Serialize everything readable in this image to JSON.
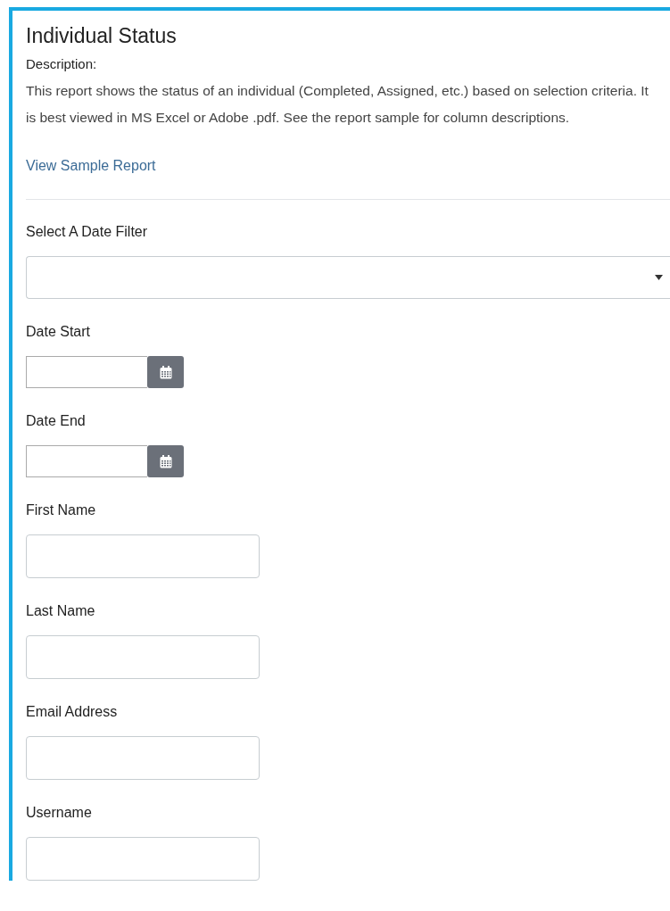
{
  "title": "Individual Status",
  "description_label": "Description:",
  "description": "This report shows the status of an individual (Completed, Assigned, etc.) based on selection criteria. It is best viewed in MS Excel or Adobe .pdf. See the report sample for column descriptions.",
  "link": "View Sample Report",
  "fields": [
    {
      "kind": "select",
      "label": "Select A Date Filter"
    },
    {
      "kind": "date",
      "label": "Date Start"
    },
    {
      "kind": "date",
      "label": "Date End"
    },
    {
      "kind": "text",
      "label": "First Name"
    },
    {
      "kind": "text",
      "label": "Last Name"
    },
    {
      "kind": "text",
      "label": "Email Address"
    },
    {
      "kind": "text",
      "label": "Username"
    }
  ]
}
